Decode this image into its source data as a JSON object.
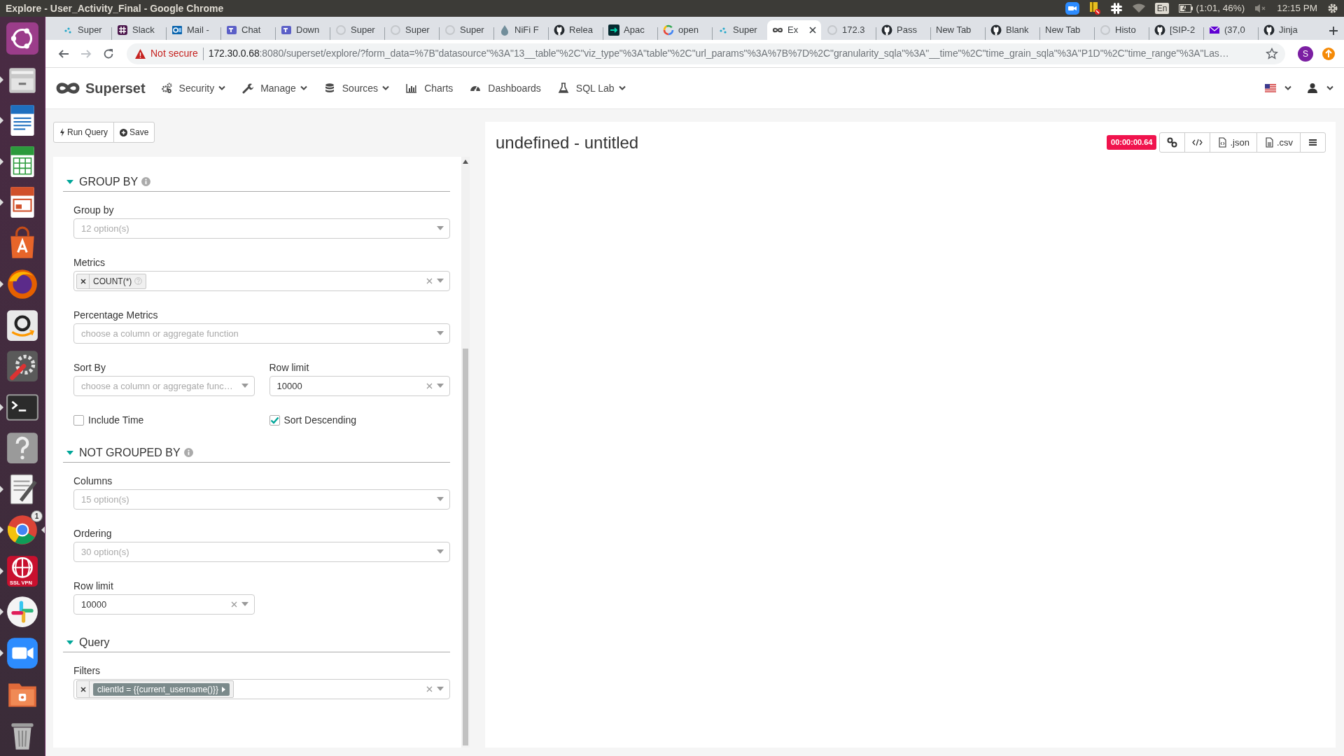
{
  "desktop": {
    "window_title": "Explore - User_Activity_Final - Google Chrome",
    "keyboard": "En",
    "battery": "(1:01, 46%)",
    "clock": "12:15 PM"
  },
  "launcher": [
    {
      "kind": "dash",
      "running": false,
      "focused": false
    },
    {
      "kind": "drawer",
      "running": true,
      "focused": false
    },
    {
      "kind": "writer",
      "running": true,
      "focused": false
    },
    {
      "kind": "calc",
      "running": true,
      "focused": false
    },
    {
      "kind": "impress",
      "running": true,
      "focused": false
    },
    {
      "kind": "store",
      "running": false,
      "focused": false
    },
    {
      "kind": "firefox",
      "running": true,
      "focused": false
    },
    {
      "kind": "amazon",
      "running": false,
      "focused": false
    },
    {
      "kind": "settings",
      "running": false,
      "focused": false
    },
    {
      "kind": "terminal",
      "running": true,
      "focused": false
    },
    {
      "kind": "help",
      "running": false,
      "focused": false
    },
    {
      "kind": "editor",
      "running": true,
      "focused": false
    },
    {
      "kind": "chrome",
      "running": true,
      "focused": true,
      "badge": "1"
    },
    {
      "kind": "vpn",
      "running": true,
      "focused": false,
      "label": "SSL VPN"
    },
    {
      "kind": "slack",
      "running": true,
      "focused": false
    },
    {
      "kind": "zoom",
      "running": true,
      "focused": false
    },
    {
      "kind": "files",
      "running": false,
      "focused": false
    },
    {
      "kind": "trash",
      "running": false,
      "focused": false
    }
  ],
  "tabs": [
    {
      "title": "Super",
      "kind": "dots",
      "selected": false
    },
    {
      "title": "Slack",
      "kind": "slack",
      "selected": false
    },
    {
      "title": "Mail -",
      "kind": "outlook",
      "selected": false
    },
    {
      "title": "Chat",
      "kind": "teams",
      "selected": false
    },
    {
      "title": "Down",
      "kind": "teams",
      "selected": false
    },
    {
      "title": "Super",
      "kind": "loading",
      "selected": false
    },
    {
      "title": "Super",
      "kind": "loading",
      "selected": false
    },
    {
      "title": "Super",
      "kind": "loading",
      "selected": false
    },
    {
      "title": "NiFi F",
      "kind": "drop",
      "selected": false
    },
    {
      "title": "Relea",
      "kind": "github",
      "selected": false
    },
    {
      "title": "Apac",
      "kind": "apache",
      "selected": false
    },
    {
      "title": "open",
      "kind": "google",
      "selected": false
    },
    {
      "title": "Super",
      "kind": "dots",
      "selected": false
    },
    {
      "title": "Ex",
      "kind": "infinity",
      "selected": true
    },
    {
      "title": "172.3",
      "kind": "loading",
      "selected": false
    },
    {
      "title": "Pass",
      "kind": "github",
      "selected": false
    },
    {
      "title": "New Tab",
      "kind": "none",
      "selected": false
    },
    {
      "title": "Blank",
      "kind": "github",
      "selected": false
    },
    {
      "title": "New Tab",
      "kind": "none",
      "selected": false
    },
    {
      "title": "Histo",
      "kind": "loading",
      "selected": false
    },
    {
      "title": "[SIP-2",
      "kind": "github",
      "selected": false
    },
    {
      "title": "(37,0",
      "kind": "envelope",
      "selected": false
    },
    {
      "title": "Jinja",
      "kind": "github",
      "selected": false
    }
  ],
  "browser": {
    "nav": [
      {
        "kind": "back",
        "disabled": false
      },
      {
        "kind": "forward",
        "disabled": true
      },
      {
        "kind": "reload",
        "disabled": false
      }
    ],
    "security": "Not secure",
    "host": "172.30.0.68",
    "path": ":8080/superset/explore/?form_data=%7B\"datasource\"%3A\"13__table\"%2C\"viz_type\"%3A\"table\"%2C\"url_params\"%3A%7B%7D%2C\"granularity_sqla\"%3A\"__time\"%2C\"time_grain_sqla\"%3A\"P1D\"%2C\"time_range\"%3A\"Las…",
    "profile": "S"
  },
  "superset": {
    "brand": "Superset",
    "menu": [
      {
        "label": "Security",
        "kind": "gears",
        "dropdown": true
      },
      {
        "label": "Manage",
        "kind": "wrench",
        "dropdown": true
      },
      {
        "label": "Sources",
        "kind": "database",
        "dropdown": true
      },
      {
        "label": "Charts",
        "kind": "bars",
        "dropdown": false
      },
      {
        "label": "Dashboards",
        "kind": "gauge",
        "dropdown": false
      },
      {
        "label": "SQL Lab",
        "kind": "flask",
        "dropdown": true
      }
    ],
    "right": [
      {
        "kind": "flag",
        "dropdown": true
      },
      {
        "kind": "user",
        "dropdown": true
      }
    ]
  },
  "query_buttons": [
    {
      "label": "Run Query",
      "kind": "bolt"
    },
    {
      "label": "Save",
      "kind": "plus"
    }
  ],
  "sections": [
    {
      "title": "GROUP BY",
      "expanded": true,
      "info": true,
      "rows": [
        [
          {
            "label": "Group by",
            "kind": "select",
            "placeholder": "12 option(s)",
            "clearable": false
          }
        ],
        [
          {
            "label": "Metrics",
            "kind": "tags",
            "tags": [
              {
                "text": "COUNT(*)",
                "kind": "metric",
                "help": true
              }
            ],
            "clearable": true
          }
        ],
        [
          {
            "label": "Percentage Metrics",
            "kind": "select",
            "placeholder": "choose a column or aggregate function",
            "clearable": false
          }
        ],
        [
          {
            "label": "Sort By",
            "kind": "select",
            "placeholder": "choose a column or aggregate func…",
            "clearable": false
          },
          {
            "label": "Row limit",
            "kind": "select",
            "value": "10000",
            "clearable": true
          }
        ],
        [
          {
            "kind": "checkbox",
            "label": "Include Time",
            "checked": false
          },
          {
            "kind": "checkbox",
            "label": "Sort Descending",
            "checked": true
          }
        ]
      ]
    },
    {
      "title": "NOT GROUPED BY",
      "expanded": true,
      "info": true,
      "rows": [
        [
          {
            "label": "Columns",
            "kind": "select",
            "placeholder": "15 option(s)",
            "clearable": false
          }
        ],
        [
          {
            "label": "Ordering",
            "kind": "select",
            "placeholder": "30 option(s)",
            "clearable": false
          }
        ],
        [
          {
            "label": "Row limit",
            "kind": "select",
            "value": "10000",
            "clearable": true
          },
          null
        ]
      ]
    },
    {
      "title": "Query",
      "expanded": true,
      "info": false,
      "rows": [
        [
          {
            "label": "Filters",
            "kind": "tags",
            "tags": [
              {
                "text": "clientId = {{current_username()}}",
                "kind": "filter",
                "help": false
              }
            ],
            "clearable": true
          }
        ]
      ]
    }
  ],
  "chart": {
    "title": "undefined - untitled",
    "timer": "00:00:00.64",
    "actions": [
      {
        "kind": "link"
      },
      {
        "kind": "code"
      },
      {
        "kind": "json",
        "label": ".json"
      },
      {
        "kind": "csv",
        "label": ".csv"
      },
      {
        "kind": "menu"
      }
    ]
  }
}
